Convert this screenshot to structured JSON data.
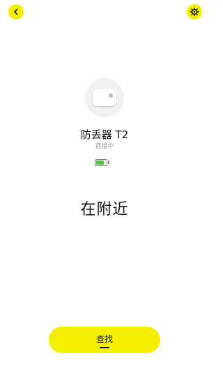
{
  "header": {
    "back_icon": "chevron-left-icon",
    "settings_icon": "gear-icon"
  },
  "device": {
    "name": "防丢器 T2",
    "status": "连接中",
    "battery_level": 0.8,
    "battery_color": "#4fc63b"
  },
  "proximity_text": "在附近",
  "action": {
    "find_label": "查找"
  },
  "colors": {
    "accent": "#f5f000",
    "background": "#ffffff"
  }
}
